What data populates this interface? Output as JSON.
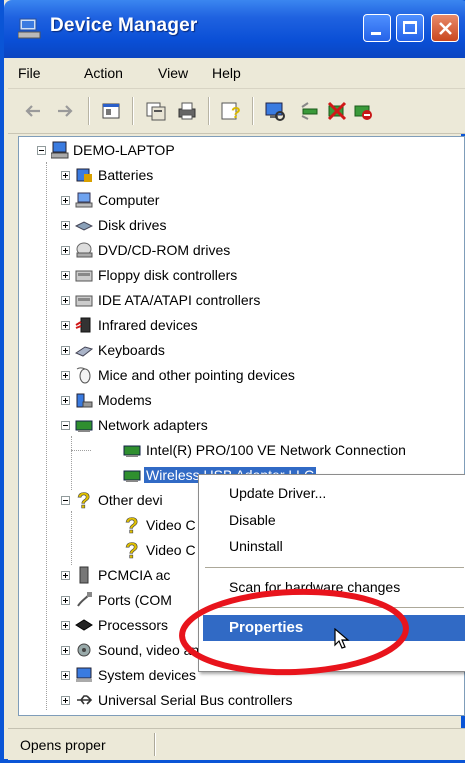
{
  "window": {
    "title": "Device Manager"
  },
  "menu": [
    "File",
    "Action",
    "View",
    "Help"
  ],
  "toolbar": {
    "icons": [
      "back-arrow-icon",
      "forward-arrow-icon",
      "show-hide-tree-icon",
      "properties-icon",
      "print-icon",
      "help-icon",
      "scan-hardware-icon",
      "update-driver-icon",
      "uninstall-icon",
      "disable-icon"
    ]
  },
  "tree": {
    "root": "DEMO-LAPTOP",
    "categories": [
      "Batteries",
      "Computer",
      "Disk drives",
      "DVD/CD-ROM drives",
      "Floppy disk controllers",
      "IDE ATA/ATAPI controllers",
      "Infrared devices",
      "Keyboards",
      "Mice and other pointing devices",
      "Modems",
      "Network adapters",
      "Intel(R) PRO/100 VE Network Connection",
      "Wireless USB Adapter LLC",
      "Other devi",
      "Video C",
      "Video C",
      "PCMCIA ac",
      "Ports (COM",
      "Processors",
      "Sound, video and game controllers",
      "System devices",
      "Universal Serial Bus controllers"
    ]
  },
  "context_menu": {
    "items": [
      "Update Driver...",
      "Disable",
      "Uninstall",
      "Scan for hardware changes",
      "Properties"
    ],
    "highlighted": "Properties"
  },
  "status": {
    "text": "Opens proper"
  },
  "colors": {
    "titlebar": "#0a4fd6",
    "selection": "#316ac5",
    "annotation": "#e8141c"
  }
}
